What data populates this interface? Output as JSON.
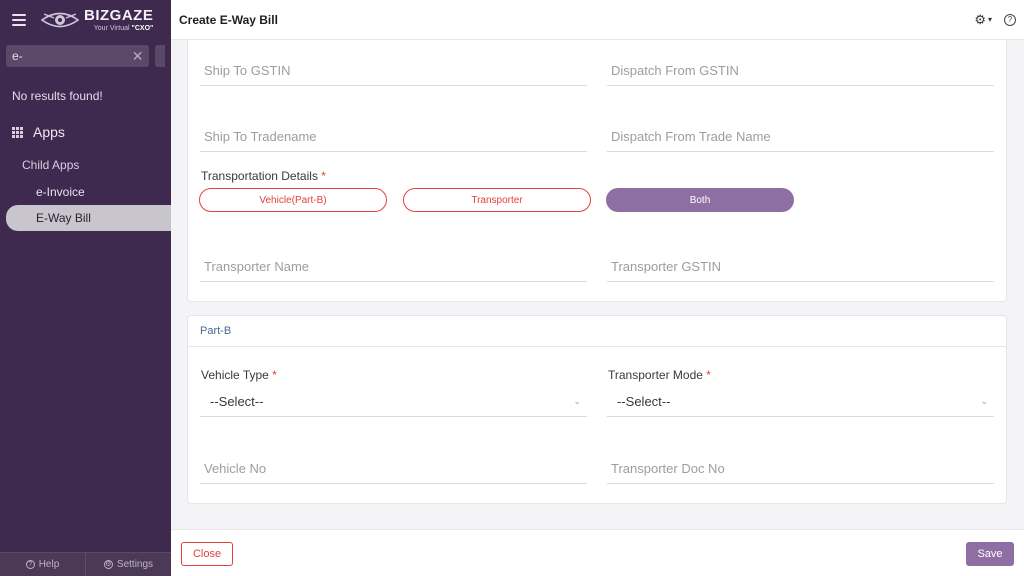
{
  "sidebar": {
    "logo": {
      "brand": "BIZGAZE",
      "tagline_prefix": "Your Virtual",
      "tagline_emphasis": "\"CXO\"",
      "icon": "eye-logo-icon"
    },
    "search": {
      "value": "e-",
      "clear_icon": "close-icon"
    },
    "no_results": "No results found!",
    "apps_label": "Apps",
    "section_label": "Child Apps",
    "items": [
      {
        "label": "e-Invoice",
        "active": false
      },
      {
        "label": "E-Way Bill",
        "active": true
      }
    ],
    "footer": {
      "help": "Help",
      "settings": "Settings"
    }
  },
  "panel": {
    "title": "Create E-Way Bill",
    "icons": {
      "settings": "gear-icon",
      "dropdown": "chevron-down-icon",
      "help": "question-circle-icon"
    }
  },
  "form": {
    "ship_to_gstin": "Ship To GSTIN",
    "dispatch_from_gstin": "Dispatch From GSTIN",
    "ship_to_tradename": "Ship To Tradename",
    "dispatch_from_trade_name": "Dispatch From Trade Name",
    "transportation_details": {
      "label": "Transportation Details",
      "required_mark": "*",
      "options": [
        "Vehicle(Part-B)",
        "Transporter",
        "Both"
      ],
      "selected": "Both"
    },
    "transporter_name": "Transporter Name",
    "transporter_gstin": "Transporter GSTIN"
  },
  "part_b": {
    "title": "Part-B",
    "vehicle_type": {
      "label": "Vehicle Type",
      "required_mark": "*",
      "value": "--Select--"
    },
    "transporter_mode": {
      "label": "Transporter Mode",
      "required_mark": "*",
      "value": "--Select--"
    },
    "vehicle_no": "Vehicle No",
    "transporter_doc_no": "Transporter Doc No"
  },
  "footer": {
    "close_label": "Close",
    "save_label": "Save"
  },
  "colors": {
    "sidebar_bg": "#3e2a4f",
    "accent": "#8f6ea3",
    "danger": "#e5413b"
  }
}
